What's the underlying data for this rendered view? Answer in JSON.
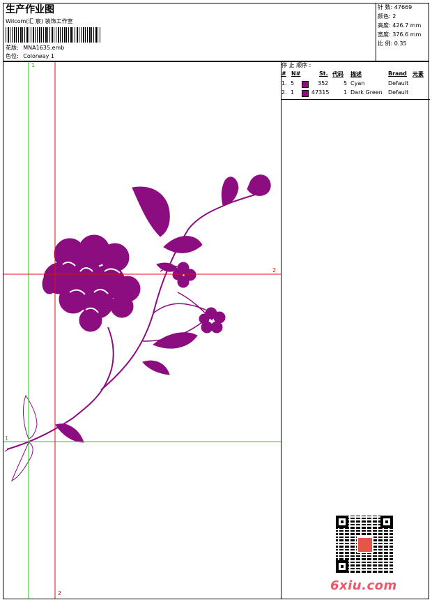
{
  "header": {
    "title": "生产作业图",
    "studio": "Wilcom(汇 宸) 装饰工作室",
    "design_label": "花版:",
    "design_file": "MNA1635.emb",
    "colorway_label": "色位:",
    "colorway": "Colorway 1"
  },
  "stats": [
    {
      "label": "针 数:",
      "value": "47669"
    },
    {
      "label": "颜色:",
      "value": "2"
    },
    {
      "label": "高度:",
      "value": "426.7 mm"
    },
    {
      "label": "宽度:",
      "value": "376.6 mm"
    },
    {
      "label": "比 例:",
      "value": "0.35"
    }
  ],
  "stop_sequence": {
    "title": "停 止 顺序 :",
    "columns": [
      "#",
      "N#",
      "St.",
      "代码",
      "描述",
      "Brand",
      "元素"
    ],
    "rows": [
      {
        "index": "1.",
        "n": "5",
        "color": "#8b0d80",
        "stitches": "352",
        "code": "5",
        "description": "Cyan",
        "brand": "Default"
      },
      {
        "index": "2.",
        "n": "1",
        "color": "#8b0d80",
        "stitches": "47315",
        "code": "1",
        "description": "Dark Green",
        "brand": "Default"
      }
    ]
  },
  "guides": {
    "v_top": "1",
    "h_right": "2",
    "h_left": "1",
    "v_bottom": "2"
  },
  "watermark": "6xiu.com",
  "colors": {
    "flower": "#8b0d80",
    "guide_green": "#22cc22",
    "guide_red": "#dd1111"
  }
}
